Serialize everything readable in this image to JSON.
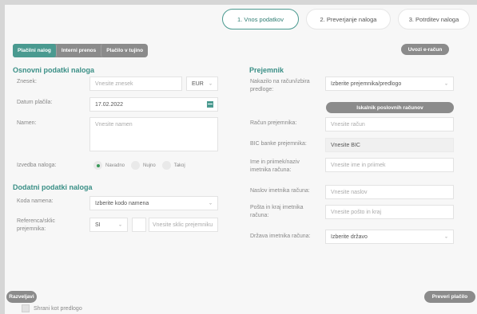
{
  "steps": [
    {
      "label": "1.  Vnos podatkov",
      "active": true
    },
    {
      "label": "2.  Preverjanje naloga",
      "active": false
    },
    {
      "label": "3.  Potrditev naloga",
      "active": false
    }
  ],
  "tabs": [
    "Plačilni nalog",
    "Interni prenos",
    "Plačilo v tujino"
  ],
  "einvoice_button": "Uvozi e-račun",
  "left": {
    "section1_title": "Osnovni podatki naloga",
    "amount_label": "Znesek:",
    "amount_placeholder": "Vnesite znesek",
    "currency": "EUR",
    "date_label": "Datum plačila:",
    "date_value": "17.02.2022",
    "purpose_label": "Namen:",
    "purpose_placeholder": "Vnesite namen",
    "execution_label": "Izvedba naloga:",
    "execution_options": [
      "Navadno",
      "Nujno",
      "Takoj"
    ],
    "section2_title": "Dodatni podatki naloga",
    "purpose_code_label": "Koda namena:",
    "purpose_code_value": "Izberite kodo namena",
    "reference_label": "Referenca/sklic prejemnika:",
    "reference_prefix": "SI",
    "reference_placeholder": "Vnesite sklic prejemniku"
  },
  "right": {
    "section_title": "Prejemnik",
    "payee_label": "Nakazilo na račun/izbira predloge:",
    "payee_value": "Izberite prejemnika/predlogo",
    "search_button": "Iskalnik poslovnih računov",
    "account_label": "Račun prejemnika:",
    "account_placeholder": "Vnesite račun",
    "bic_label": "BIC banke prejemnika:",
    "bic_placeholder": "Vnesite BIC",
    "holder_label": "Ime in priimek/naziv imetnika računa:",
    "holder_placeholder": "Vnesite ime in priimek",
    "address_label": "Naslov imetnika računa:",
    "address_placeholder": "Vnesite naslov",
    "post_label": "Pošta in kraj imetnika računa:",
    "post_placeholder": "Vnesite pošto in kraj",
    "country_label": "Država imetnika računa:",
    "country_value": "Izberite državo"
  },
  "footer": {
    "cancel_button": "Razveljavi",
    "check_button": "Preveri plačilo",
    "save_template_label": "Shrani kot predlogo"
  }
}
